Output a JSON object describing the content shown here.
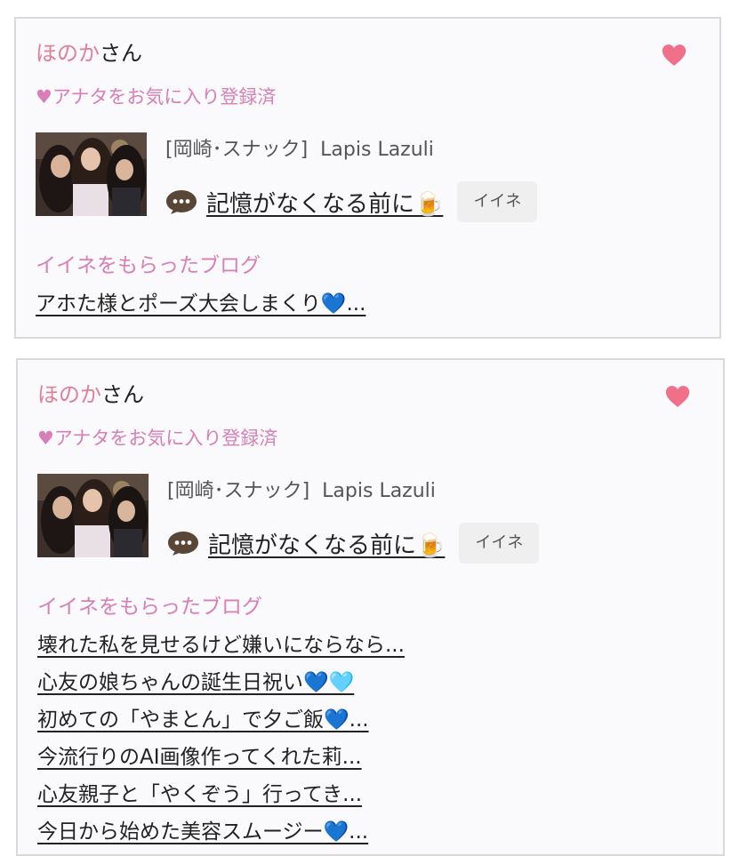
{
  "cards": [
    {
      "user_name": "ほのか",
      "user_suffix": "さん",
      "fav_status": "♥アナタをお気に入り登録済",
      "shop": {
        "category": "[岡崎･スナック]",
        "name": "Lapis Lazuli"
      },
      "comment": "記憶がなくなる前に🍺",
      "like_button": "イイネ",
      "section_title": "イイネをもらったブログ",
      "blogs": [
        "アホた様とポーズ大会しまくり💙..."
      ]
    },
    {
      "user_name": "ほのか",
      "user_suffix": "さん",
      "fav_status": "♥アナタをお気に入り登録済",
      "shop": {
        "category": "[岡崎･スナック]",
        "name": "Lapis Lazuli"
      },
      "comment": "記憶がなくなる前に🍺",
      "like_button": "イイネ",
      "section_title": "イイネをもらったブログ",
      "blogs": [
        "壊れた私を見せるけど嫌いにならなら...",
        "心友の娘ちゃんの誕生日祝い💙🩵",
        "初めての「やまとん」で夕ご飯💙...",
        "今流行りのAI画像作ってくれた莉...",
        "心友親子と「やくぞう」行ってき...",
        "今日から始めた美容スムージー💙..."
      ]
    }
  ],
  "colors": {
    "name_pink": "#e07f96",
    "label_pink": "#d77fb6",
    "heart": "#f07089",
    "button_bg": "#efefef",
    "border": "#d9d9d9"
  },
  "icons": [
    "heart-icon",
    "speech-bubble-icon",
    "beer-icon",
    "photo-thumbnail"
  ]
}
